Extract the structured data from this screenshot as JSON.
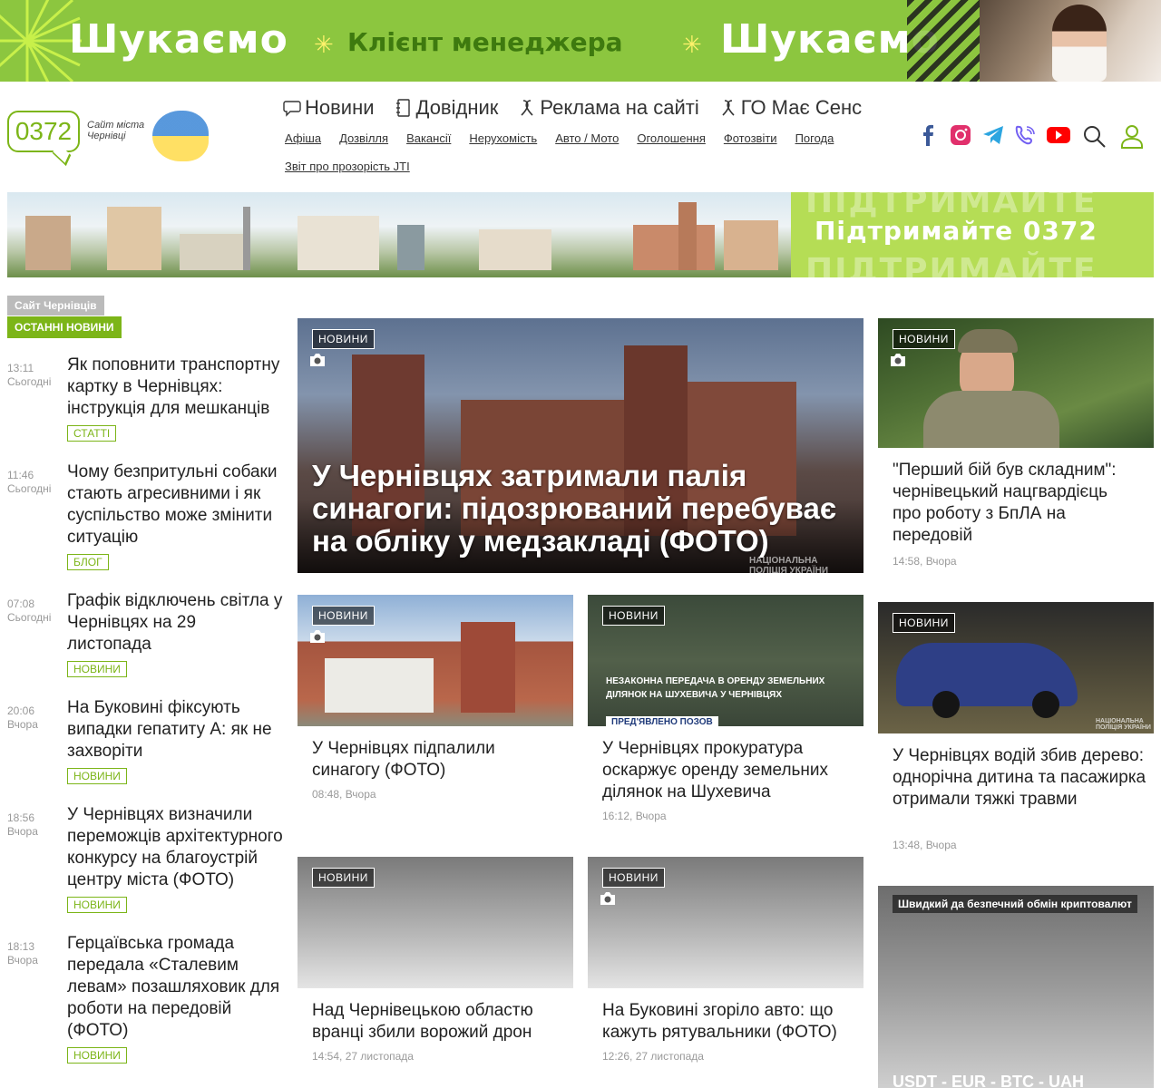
{
  "top_banner": {
    "word_left": "Шукаємо",
    "word_middle": "Клієнт менеджера",
    "word_right": "Шукаємо"
  },
  "logo": {
    "code": "0372",
    "subtitle": "Сайт міста Чернівці"
  },
  "main_nav": [
    {
      "label": "Новини",
      "icon": "chat-bubble-icon"
    },
    {
      "label": "Довідник",
      "icon": "notebook-icon"
    },
    {
      "label": "Реклама на сайті",
      "icon": "ribbon-icon"
    },
    {
      "label": "ГО Має Сенс",
      "icon": "ribbon-icon"
    }
  ],
  "sub_nav": [
    "Афіша",
    "Дозвілля",
    "Вакансії",
    "Нерухомість",
    "Авто / Мото",
    "Оголошення",
    "Фотозвіти",
    "Погода",
    "Звіт про прозорість JTI"
  ],
  "socials": [
    {
      "name": "facebook-icon",
      "color": "#3b5998"
    },
    {
      "name": "instagram-icon",
      "color": "#e1306c"
    },
    {
      "name": "telegram-icon",
      "color": "#2ca5e0"
    },
    {
      "name": "viber-icon",
      "color": "#7360f2"
    },
    {
      "name": "youtube-icon",
      "color": "#ff0000"
    }
  ],
  "support_banner": {
    "text": "Підтримайте 0372",
    "ghost": "ПІДТРИМАЙТЕ"
  },
  "left": {
    "site_tag": "Сайт Чернівців",
    "latest_tag": "ОСТАННІ НОВИНИ",
    "items": [
      {
        "time": "13:11",
        "day": "Сьогодні",
        "title": "Як поповнити транспортну картку в Чернівцях: інструкція для мешканців",
        "cat": "СТАТТІ"
      },
      {
        "time": "11:46",
        "day": "Сьогодні",
        "title": "Чому безпритульні собаки стають агресивними і як суспільство може змінити ситуацію",
        "cat": "БЛОГ"
      },
      {
        "time": "07:08",
        "day": "Сьогодні",
        "title": "Графік відключень світла у Чернівцях на 29 листопада",
        "cat": "НОВИНИ"
      },
      {
        "time": "20:06",
        "day": "Вчора",
        "title": "На Буковині фіксують випадки гепатиту А: як не захворіти",
        "cat": "НОВИНИ"
      },
      {
        "time": "18:56",
        "day": "Вчора",
        "title": "У Чернівцях визначили переможців архітектурного конкурсу на благоустрій центру міста (ФОТО)",
        "cat": "НОВИНИ"
      },
      {
        "time": "18:13",
        "day": "Вчора",
        "title": "Герцаївська громада передала «Сталевим левам» позашляховик для роботи на передовій (ФОТО)",
        "cat": "НОВИНИ"
      }
    ]
  },
  "hero": {
    "badge": "НОВИНИ",
    "title": "У Чернівцях затримали палія синагоги: підозрюваний перебуває на обліку у медзакладі (ФОТО)",
    "watermark": "НАЦІОНАЛЬНА ПОЛІЦІЯ УКРАЇНИ"
  },
  "cards": {
    "c1": {
      "badge": "НОВИНИ",
      "title": "У Чернівцях підпалили синагогу (ФОТО)",
      "meta": "08:48, Вчора"
    },
    "c2": {
      "badge": "НОВИНИ",
      "title": "У Чернівцях прокуратура оскаржує оренду земельних ділянок на Шухевича",
      "meta": "16:12, Вчора",
      "img_caption": "НЕЗАКОННА ПЕРЕДАЧА В ОРЕНДУ ЗЕМЕЛЬНИХ ДІЛЯНОК НА ШУХЕВИЧА У ЧЕРНІВЦЯХ",
      "img_sub": "ПРЕД'ЯВЛЕНО ПОЗОВ"
    },
    "c3": {
      "badge": "НОВИНИ",
      "title": "Над Чернівецькою областю вранці збили ворожий дрон",
      "meta": "14:54, 27 листопада"
    },
    "c4": {
      "badge": "НОВИНИ",
      "title": "На Буковині згоріло авто: що кажуть рятувальники (ФОТО)",
      "meta": "12:26, 27 листопада"
    },
    "r1": {
      "badge": "НОВИНИ",
      "title": "\"Перший бій був складним\": чернівецький нацгвардієць про роботу з БпЛА на передовій",
      "meta": "14:58, Вчора"
    },
    "r2": {
      "badge": "НОВИНИ",
      "title": "У Чернівцях водій збив дерево: однорічна дитина та пасажирка отримали тяжкі травми",
      "meta": "13:48, Вчора",
      "watermark": "НАЦІОНАЛЬНА ПОЛІЦІЯ УКРАЇНИ"
    }
  },
  "crypto": {
    "badge": "Швидкий да безпечний обмін криптовалют",
    "title": "USDT - EUR - BTC - UAH"
  },
  "colors": {
    "accent": "#7cb518",
    "banner_green": "#8cc63f"
  }
}
